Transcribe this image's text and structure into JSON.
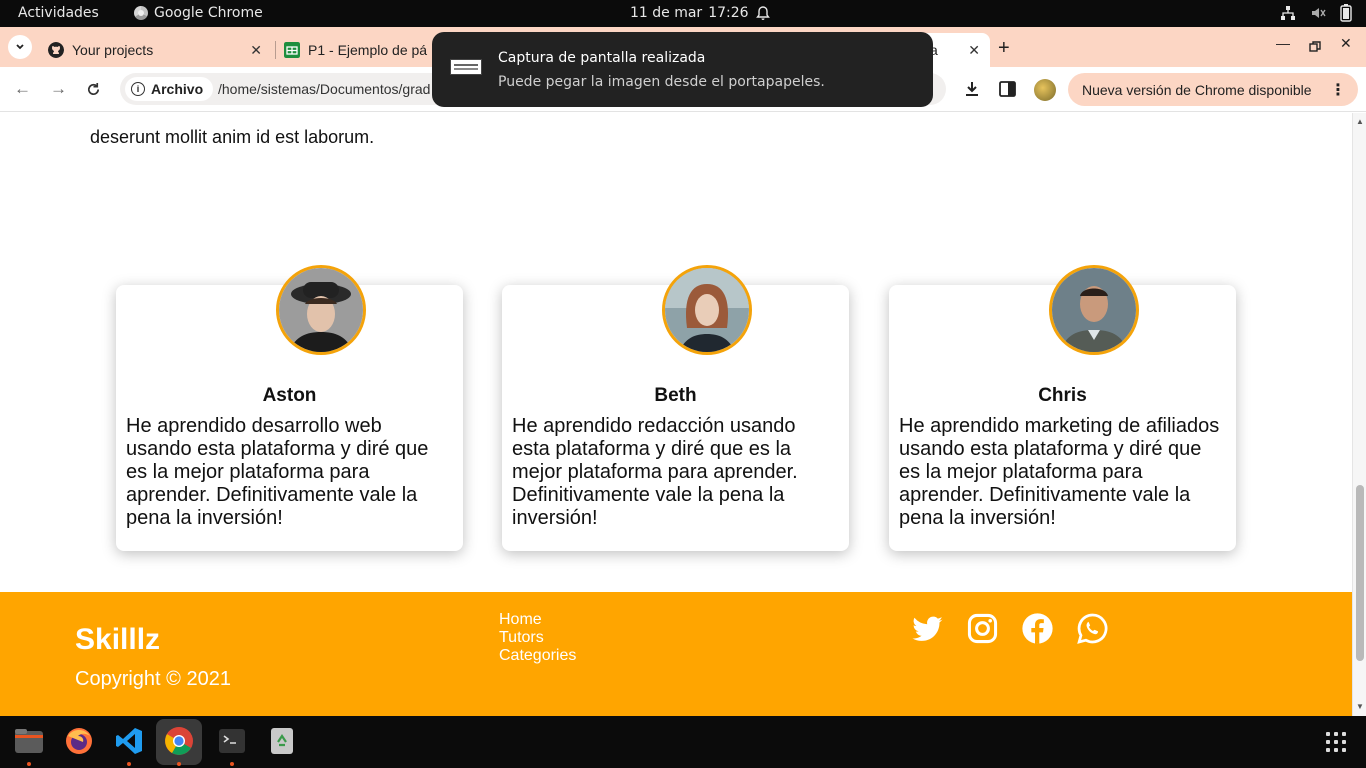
{
  "topbar": {
    "activities": "Actividades",
    "app_name": "Google Chrome",
    "date": "11 de mar",
    "time": "17:26"
  },
  "tabs": [
    {
      "label": "Your projects",
      "icon": "github-icon"
    },
    {
      "label": "P1 - Ejemplo de pá",
      "icon": "sheets-icon"
    },
    {
      "label": "a",
      "icon": "page-icon"
    }
  ],
  "toolbar": {
    "chip_label": "Archivo",
    "url": "/home/sistemas/Documentos/grad",
    "update_label": "Nueva versión de Chrome disponible"
  },
  "notification": {
    "title": "Captura de pantalla realizada",
    "body": "Puede pegar la imagen desde el portapapeles."
  },
  "page": {
    "paragraph_tail": "deserunt mollit anim id est laborum.",
    "testimonials": [
      {
        "name": "Aston",
        "text": "He aprendido desarrollo web usando esta plataforma y diré que es la mejor plataforma para aprender. Definitivamente vale la pena la inversión!"
      },
      {
        "name": "Beth",
        "text": "He aprendido redacción usando esta plataforma y diré que es la mejor plataforma para aprender. Definitivamente vale la pena la inversión!"
      },
      {
        "name": "Chris",
        "text": "He aprendido marketing de afiliados usando esta plataforma y diré que es la mejor plataforma para aprender. Definitivamente vale la pena la inversión!"
      }
    ],
    "footer": {
      "brand": "Skilllz",
      "copyright": "Copyright © 2021",
      "links": [
        "Home",
        "Tutors",
        "Categories"
      ],
      "socials": [
        "twitter-icon",
        "instagram-icon",
        "facebook-icon",
        "whatsapp-icon"
      ]
    }
  },
  "colors": {
    "accent": "#ffa500",
    "avatar_border": "#f4a30a",
    "tab_strip": "#fcd6c4"
  }
}
